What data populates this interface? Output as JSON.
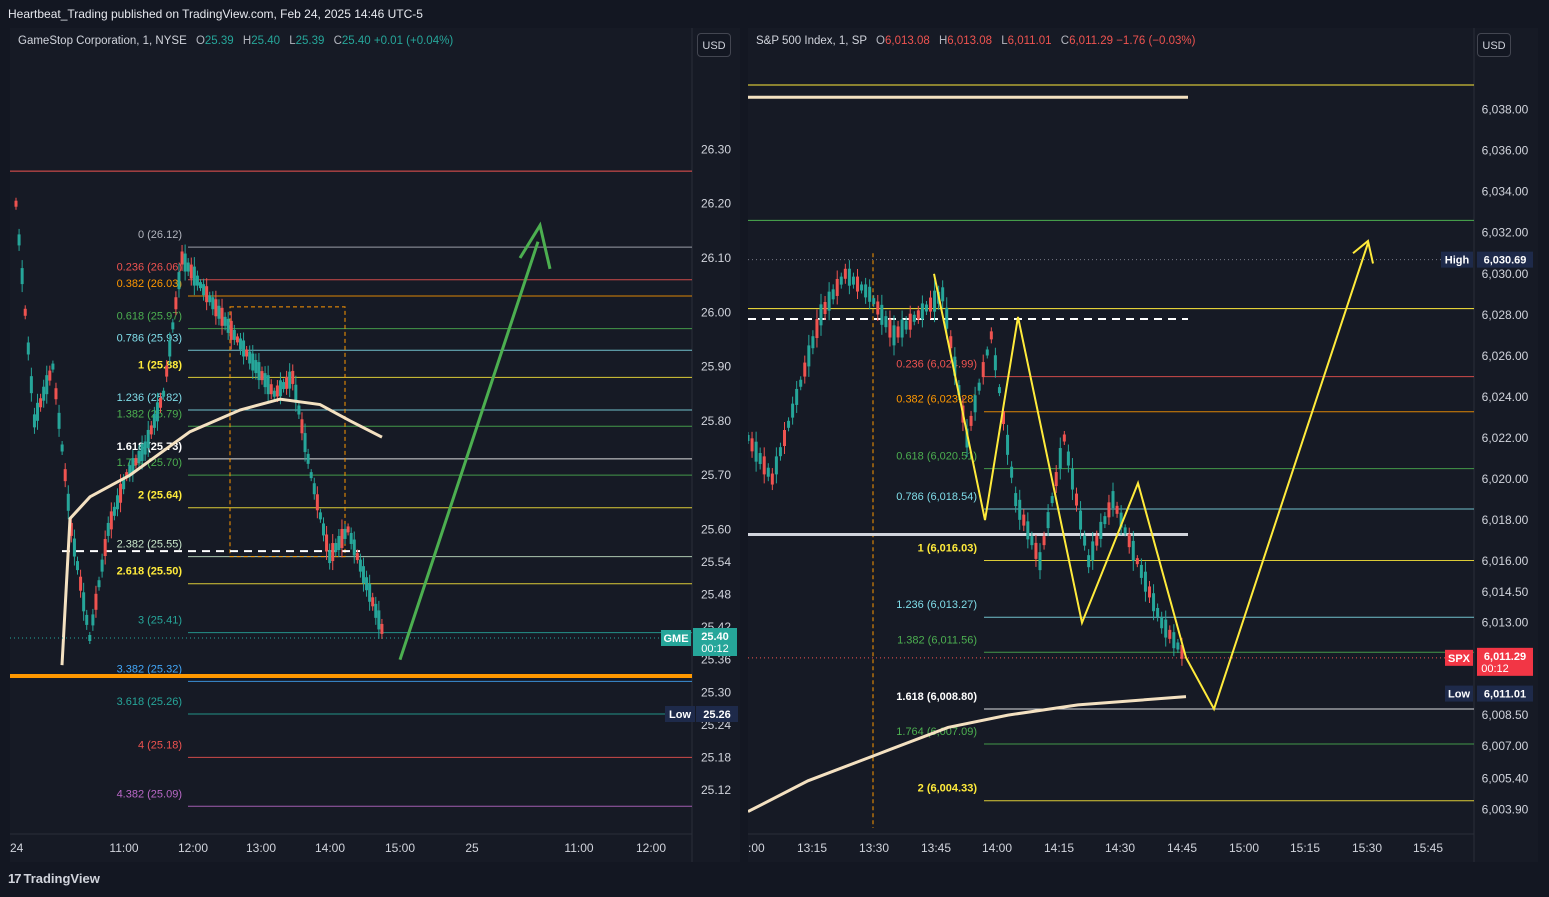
{
  "header": {
    "title": "Heartbeat_Trading published on TradingView.com, Feb 24, 2025 14:46 UTC-5"
  },
  "footer": {
    "brand": "TradingView",
    "logo_icon": "tradingview-logo-icon"
  },
  "colors": {
    "background": "#131722",
    "up": "#26a69a",
    "down": "#ef5350",
    "green_arrow": "#4caf50",
    "yellow": "#ffeb3b",
    "orange": "#ff9800",
    "cream": "#f4e1c1"
  },
  "charts": {
    "gme": {
      "symbol": "GameStop Corporation, 1, NYSE",
      "o_label": "O",
      "o": "25.39",
      "h_label": "H",
      "h": "25.40",
      "l_label": "L",
      "l": "25.39",
      "c_label": "C",
      "c": "25.40",
      "change": "+0.01 (+0.04%)",
      "currency_button": "USD"
    },
    "spx": {
      "symbol": "S&P 500 Index, 1, SP",
      "o_label": "O",
      "o": "6,013.08",
      "h_label": "H",
      "h": "6,013.08",
      "l_label": "L",
      "l": "6,011.01",
      "c_label": "C",
      "c": "6,011.29",
      "change": "−1.76 (−0.03%)",
      "currency_button": "USD"
    }
  },
  "chart_data": [
    {
      "type": "line",
      "title": "GameStop Corporation, 1, NYSE",
      "ylim": [
        25.05,
        26.45
      ],
      "x_ticks": [
        "24",
        "11:00",
        "12:00",
        "13:00",
        "14:00",
        "15:00",
        "25",
        "11:00",
        "12:00"
      ],
      "y_ticks": [
        26.3,
        26.2,
        26.1,
        26.0,
        25.9,
        25.8,
        25.7,
        25.6,
        25.54,
        25.48,
        25.42,
        25.36,
        25.3,
        25.24,
        25.18,
        25.12
      ],
      "last_price": {
        "tag": "GME",
        "value": "25.40",
        "countdown": "00:12"
      },
      "low_marker": {
        "tag": "Low",
        "value": "25.26"
      },
      "fib_levels": [
        {
          "label": "0 (26.12)",
          "value": 26.12,
          "color": "#b2b5be"
        },
        {
          "label": "0.236 (26.06)",
          "value": 26.06,
          "color": "#ef5350"
        },
        {
          "label": "0.382 (26.03)",
          "value": 26.03,
          "color": "#ff9800"
        },
        {
          "label": "0.618 (25.97)",
          "value": 25.97,
          "color": "#4caf50"
        },
        {
          "label": "0.786 (25.93)",
          "value": 25.93,
          "color": "#80deea"
        },
        {
          "label": "1 (25.88)",
          "value": 25.88,
          "color": "#ffeb3b"
        },
        {
          "label": "1.236 (25.82)",
          "value": 25.82,
          "color": "#80deea"
        },
        {
          "label": "1.382 (25.79)",
          "value": 25.79,
          "color": "#4caf50"
        },
        {
          "label": "1.618 (25.73)",
          "value": 25.73,
          "color": "#ffffff"
        },
        {
          "label": "1.764 (25.70)",
          "value": 25.7,
          "color": "#4caf50"
        },
        {
          "label": "2 (25.64)",
          "value": 25.64,
          "color": "#ffeb3b"
        },
        {
          "label": "2.382 (25.55)",
          "value": 25.55,
          "color": "#c8e6c9"
        },
        {
          "label": "2.618 (25.50)",
          "value": 25.5,
          "color": "#ffeb3b"
        },
        {
          "label": "3 (25.41)",
          "value": 25.41,
          "color": "#26a69a"
        },
        {
          "label": "3.382 (25.32)",
          "value": 25.32,
          "color": "#42a5f5"
        },
        {
          "label": "3.618 (25.26)",
          "value": 25.26,
          "color": "#26a69a"
        },
        {
          "label": "4 (25.18)",
          "value": 25.18,
          "color": "#ef5350"
        },
        {
          "label": "4.382 (25.09)",
          "value": 25.09,
          "color": "#ba68c8"
        }
      ],
      "series": [
        {
          "values": [
            26.2,
            25.8,
            25.9,
            25.6,
            25.4,
            25.6,
            25.7,
            25.75,
            25.85,
            26.1,
            26.05,
            26.0,
            25.95,
            25.9,
            25.85,
            25.88,
            25.7,
            25.55,
            25.6,
            25.5,
            25.4
          ]
        }
      ]
    },
    {
      "type": "line",
      "title": "S&P 500 Index, 1, SP",
      "ylim": [
        6003.0,
        6041.0
      ],
      "x_ticks": [
        ":00",
        "13:15",
        "13:30",
        "13:45",
        "14:00",
        "14:15",
        "14:30",
        "14:45",
        "15:00",
        "15:15",
        "15:30",
        "15:45"
      ],
      "y_ticks": [
        6038.0,
        6036.0,
        6034.0,
        6032.0,
        6030.0,
        6028.0,
        6026.0,
        6024.0,
        6022.0,
        6020.0,
        6018.0,
        6016.0,
        6014.5,
        6013.0,
        6008.5,
        6007.0,
        6005.4,
        6003.9
      ],
      "last_price": {
        "tag": "SPX",
        "value": "6,011.29",
        "countdown": "00:12"
      },
      "high_marker": {
        "tag": "High",
        "value": "6,030.69"
      },
      "low_marker": {
        "tag": "Low",
        "value": "6,011.01"
      },
      "fib_levels": [
        {
          "label": "0.236 (6,024.99)",
          "value": 6024.99,
          "color": "#ef5350"
        },
        {
          "label": "0.382 (6,023.28)",
          "value": 6023.28,
          "color": "#ff9800"
        },
        {
          "label": "0.618 (6,020.51)",
          "value": 6020.51,
          "color": "#4caf50"
        },
        {
          "label": "0.786 (6,018.54)",
          "value": 6018.54,
          "color": "#80deea"
        },
        {
          "label": "1 (6,016.03)",
          "value": 6016.03,
          "color": "#ffeb3b"
        },
        {
          "label": "1.236 (6,013.27)",
          "value": 6013.27,
          "color": "#80deea"
        },
        {
          "label": "1.382 (6,011.56)",
          "value": 6011.56,
          "color": "#4caf50"
        },
        {
          "label": "1.618 (6,008.80)",
          "value": 6008.8,
          "color": "#ffffff"
        },
        {
          "label": "1.764 (6,007.09)",
          "value": 6007.09,
          "color": "#4caf50"
        },
        {
          "label": "2 (6,004.33)",
          "value": 6004.33,
          "color": "#ffeb3b"
        }
      ],
      "series": [
        {
          "values": [
            6022,
            6020,
            6024,
            6028,
            6030,
            6029,
            6027,
            6028,
            6029,
            6022,
            6027,
            6019,
            6016,
            6022,
            6016,
            6019,
            6016,
            6013,
            6011.3
          ]
        }
      ]
    }
  ]
}
